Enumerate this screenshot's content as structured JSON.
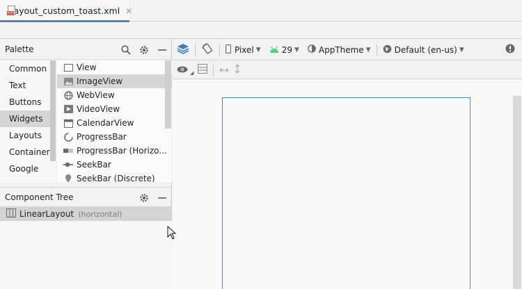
{
  "tab": {
    "file_name": "layout_custom_toast.xml",
    "close_glyph": "✕",
    "badge": "<>"
  },
  "palette": {
    "title": "Palette",
    "categories": [
      "Common",
      "Text",
      "Buttons",
      "Widgets",
      "Layouts",
      "Container",
      "Google"
    ],
    "selected_category": "Widgets",
    "widgets": [
      {
        "label": "View",
        "icon": "view-icon"
      },
      {
        "label": "ImageView",
        "icon": "image-icon"
      },
      {
        "label": "WebView",
        "icon": "globe-icon"
      },
      {
        "label": "VideoView",
        "icon": "video-icon"
      },
      {
        "label": "CalendarView",
        "icon": "calendar-icon"
      },
      {
        "label": "ProgressBar",
        "icon": "spinner-icon"
      },
      {
        "label": "ProgressBar (Horizo...",
        "icon": "progress-bar-icon"
      },
      {
        "label": "SeekBar",
        "icon": "seekbar-icon"
      },
      {
        "label": "SeekBar (Discrete)",
        "icon": "pin-icon"
      }
    ],
    "selected_widget": "ImageView"
  },
  "component_tree": {
    "title": "Component Tree",
    "root_label": "LinearLayout",
    "root_orientation": "(horizontal)"
  },
  "toolbar": {
    "device": "Pixel",
    "api_level": "29",
    "theme": "AppTheme",
    "locale": "Default (en-us)"
  },
  "colors": {
    "accent_blue": "#3f8fd0",
    "android_green": "#3ddc84",
    "selection_gray": "#d6d6d6",
    "tab_underline": "#4a86c8"
  }
}
